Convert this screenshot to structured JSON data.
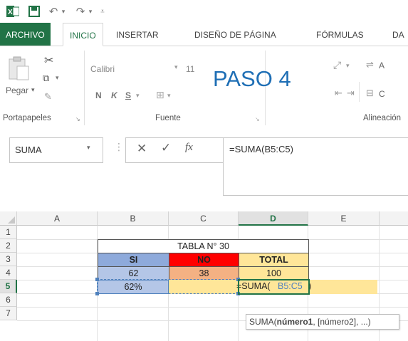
{
  "quick_access": {
    "app_icon": "excel-icon",
    "save_icon": "save-icon",
    "undo_icon": "undo-icon",
    "redo_icon": "redo-icon",
    "customize_icon": "customize-qat-icon"
  },
  "tabs": [
    "ARCHIVO",
    "INICIO",
    "INSERTAR",
    "DISEÑO DE PÁGINA",
    "FÓRMULAS",
    "DA"
  ],
  "ribbon": {
    "clipboard": {
      "paste_label": "Pegar",
      "group_label": "Portapapeles"
    },
    "font": {
      "font_name": "Calibri",
      "font_size": "11",
      "bold": "N",
      "italic": "K",
      "underline": "S",
      "group_label": "Fuente"
    },
    "overlay_text": "PASO 4",
    "alignment": {
      "group_label": "Alineación",
      "wrap_prefix": "A",
      "merge_prefix": "C"
    }
  },
  "formula_bar": {
    "name_box": "SUMA",
    "fx_label": "fx",
    "formula": "=SUMA(B5:C5)"
  },
  "grid": {
    "columns": [
      "A",
      "B",
      "C",
      "D",
      "E"
    ],
    "rows": [
      "1",
      "2",
      "3",
      "4",
      "5",
      "6",
      "7"
    ],
    "table_title": "TABLA N° 30",
    "headers": {
      "si": "SI",
      "no": "NO",
      "total": "TOTAL"
    },
    "row4": {
      "si": "62",
      "no": "38",
      "total": "100"
    },
    "row5": {
      "si": "62%",
      "formula_prefix": "=SUMA(",
      "formula_ref": "B5:C5",
      "formula_suffix": ")"
    }
  },
  "tooltip": {
    "prefix": "SUMA(",
    "arg1": "número1",
    "rest": ", [número2], ...)"
  },
  "colors": {
    "excel_green": "#217346",
    "si_blue": "#8eaadb",
    "si_light": "#b4c6e7",
    "no_red": "#ff0000",
    "no_light": "#f4b183",
    "total_yellow": "#ffe699",
    "ref_blue": "#4f81bd",
    "paso_blue": "#1f6fb5"
  }
}
